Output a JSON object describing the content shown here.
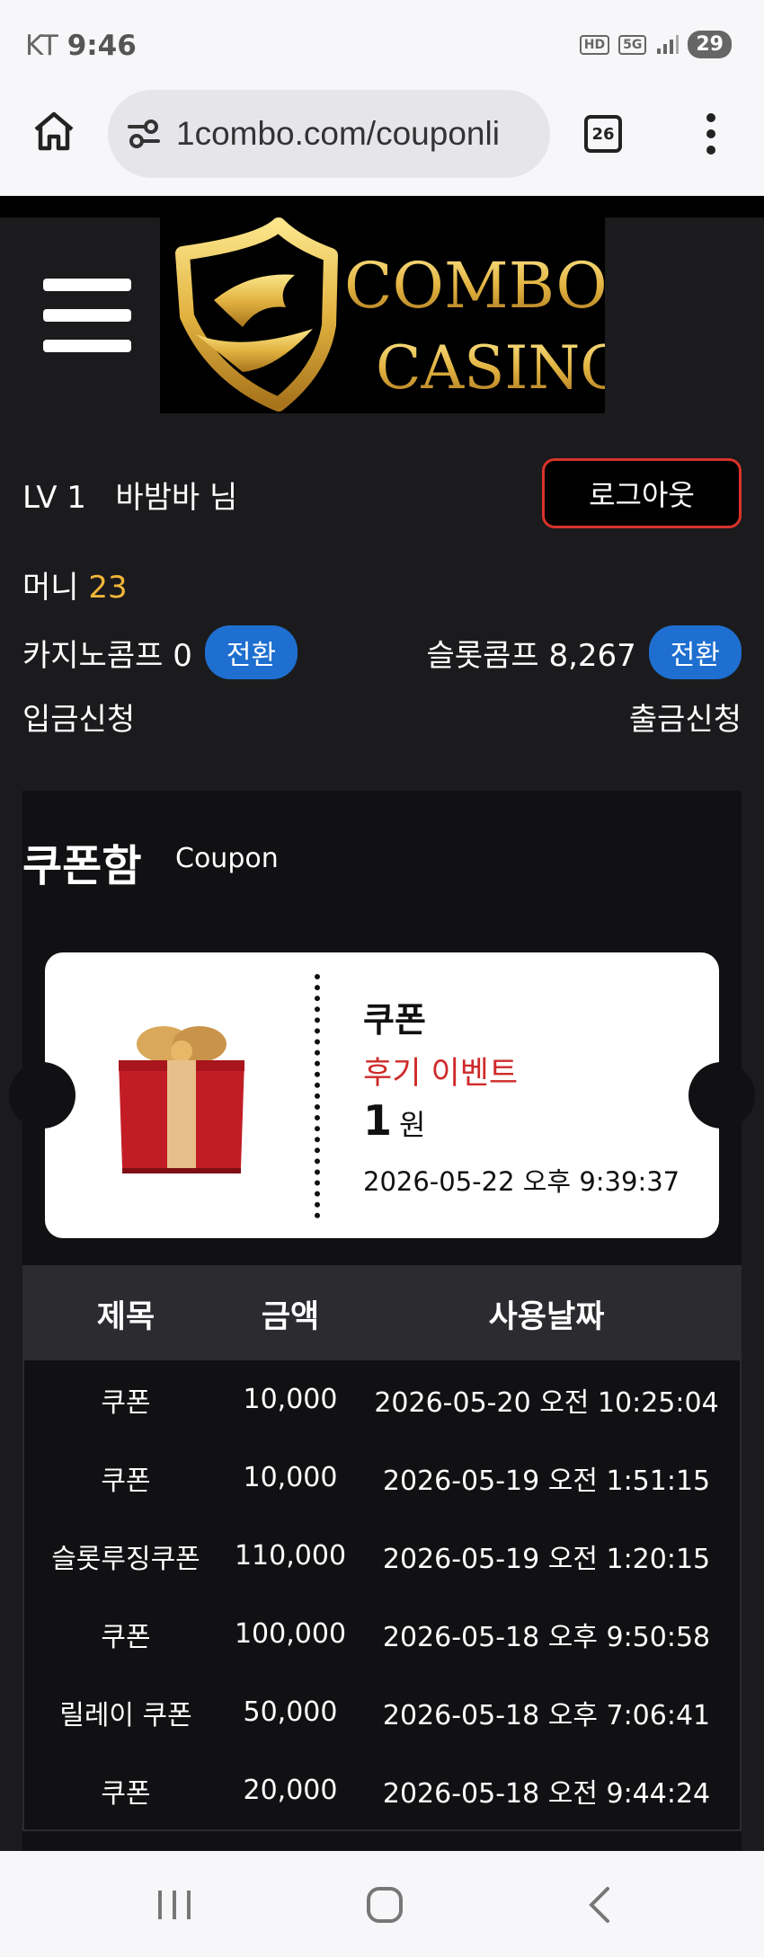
{
  "status": {
    "carrier": "KT",
    "time": "9:46",
    "icon_hd": "HD",
    "icon_5g": "5G",
    "battery": "29"
  },
  "browser": {
    "url": "1combo.com/couponli",
    "tab_count": "26"
  },
  "logo": {
    "alt": "COMBO CASINO"
  },
  "user": {
    "level": "LV 1",
    "name": "바밤바 님",
    "logout_label": "로그아웃"
  },
  "money": {
    "label": "머니",
    "value": "23"
  },
  "comps": {
    "casino_label": "카지노콤프 0",
    "slot_label": "슬롯콤프 8,267",
    "convert_label": "전환"
  },
  "links": {
    "deposit": "입금신청",
    "withdraw": "출금신청"
  },
  "coupon_box": {
    "title": "쿠폰함",
    "subtitle": "Coupon",
    "ticket": {
      "name": "쿠폰",
      "event": "후기 이벤트",
      "amount": "1",
      "unit": "원",
      "date": "2026-05-22 오후 9:39:37"
    }
  },
  "table": {
    "headers": [
      "제목",
      "금액",
      "사용날짜"
    ],
    "rows": [
      [
        "쿠폰",
        "10,000",
        "2026-05-20 오전 10:25:04"
      ],
      [
        "쿠폰",
        "10,000",
        "2026-05-19 오전 1:51:15"
      ],
      [
        "슬롯루징쿠폰",
        "110,000",
        "2026-05-19 오전 1:20:15"
      ],
      [
        "쿠폰",
        "100,000",
        "2026-05-18 오후 9:50:58"
      ],
      [
        "릴레이 쿠폰",
        "50,000",
        "2026-05-18 오후 7:06:41"
      ],
      [
        "쿠폰",
        "20,000",
        "2026-05-18 오전 9:44:24"
      ]
    ]
  },
  "colors": {
    "accent_blue": "#1e6fd0",
    "money_gold": "#f1b53a",
    "event_red": "#cf2a2a",
    "logout_border": "#d9332b"
  }
}
